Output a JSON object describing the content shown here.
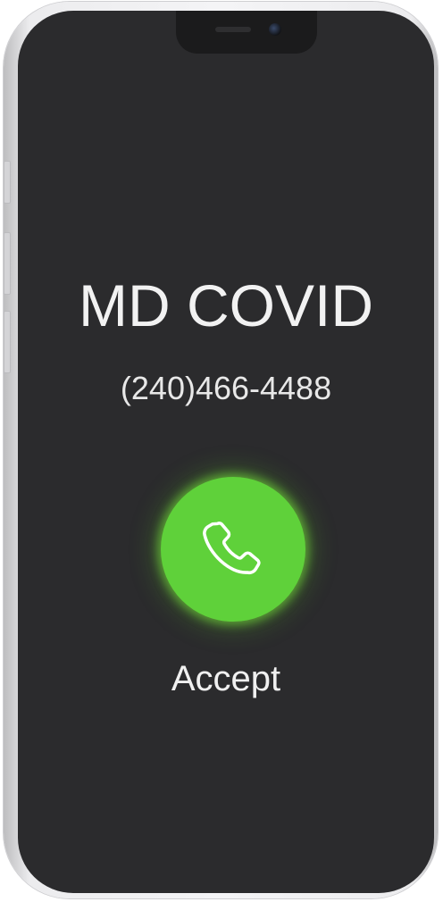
{
  "call": {
    "caller_name": "MD COVID",
    "caller_number": "(240)466-4488",
    "accept_label": "Accept"
  },
  "icons": {
    "accept": "phone-handset-icon"
  },
  "colors": {
    "screen_background": "#2b2b2d",
    "accept_green": "#5fd13a",
    "text": "#f2f2f2"
  }
}
